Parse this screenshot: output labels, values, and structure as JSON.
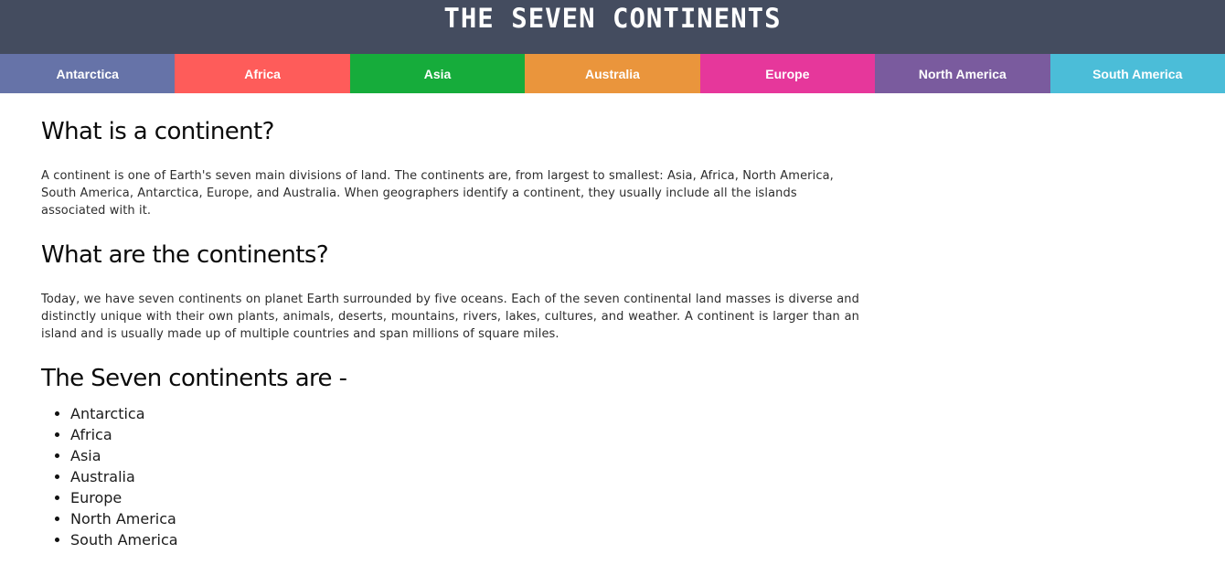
{
  "header": {
    "title": "THE SEVEN CONTINENTS"
  },
  "nav": {
    "items": [
      {
        "label": "Antarctica",
        "color": "#6673a8"
      },
      {
        "label": "Africa",
        "color": "#fe5c5a"
      },
      {
        "label": "Asia",
        "color": "#16ac3b"
      },
      {
        "label": "Australia",
        "color": "#ea953c"
      },
      {
        "label": "Europe",
        "color": "#e6379b"
      },
      {
        "label": "North America",
        "color": "#7a5b9e"
      },
      {
        "label": "South America",
        "color": "#4bbdd8"
      }
    ]
  },
  "content": {
    "section_1": {
      "heading": "What is a continent?",
      "text": "A continent is one of Earth's seven main divisions of land. The continents are, from largest to smallest: Asia, Africa, North America, South America, Antarctica, Europe, and Australia. When geographers identify a continent, they usually include all the islands associated with it."
    },
    "section_2": {
      "heading": "What are the continents?",
      "text": "Today, we have seven continents on planet Earth surrounded by five oceans. Each of the seven continental land masses is diverse and distinctly unique with their own plants, animals, deserts, mountains, rivers, lakes, cultures, and weather. A continent is larger than an island and is usually made up of multiple countries and span millions of square miles."
    },
    "section_3": {
      "heading": "The Seven continents are -",
      "list": [
        "Antarctica",
        "Africa",
        "Asia",
        "Australia",
        "Europe",
        "North America",
        "South America"
      ]
    }
  }
}
